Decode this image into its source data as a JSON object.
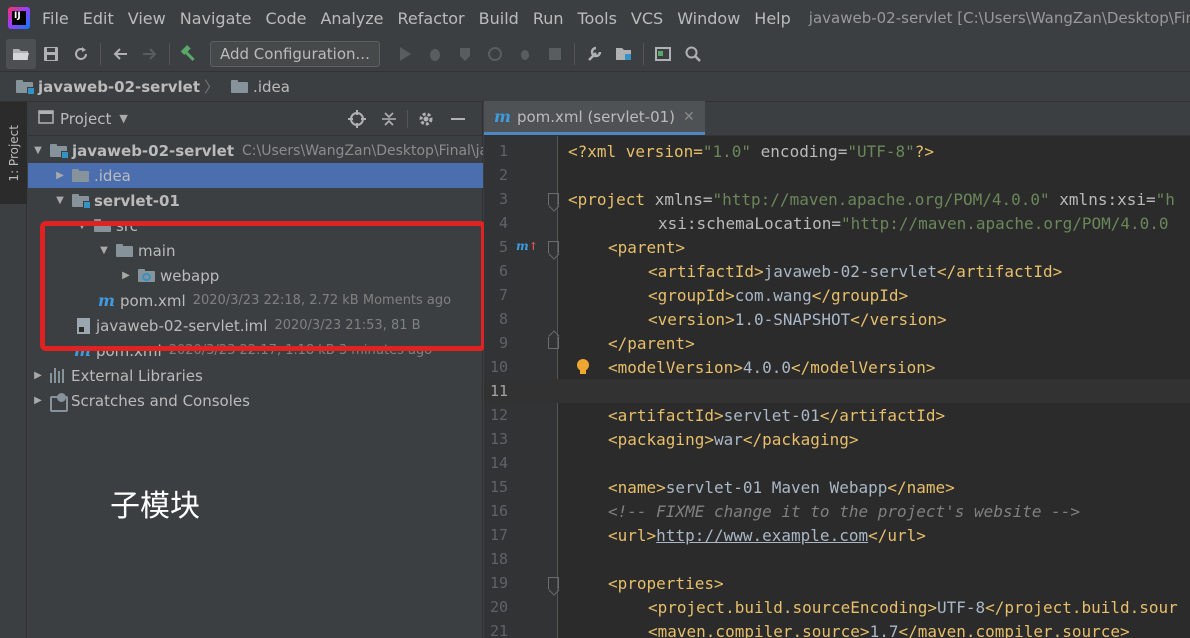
{
  "menu": {
    "items": [
      "File",
      "Edit",
      "View",
      "Navigate",
      "Code",
      "Analyze",
      "Refactor",
      "Build",
      "Run",
      "Tools",
      "VCS",
      "Window",
      "Help"
    ],
    "window_title": "javaweb-02-servlet [C:\\Users\\WangZan\\Desktop\\Final\\ja"
  },
  "toolbar": {
    "add_configuration": "Add Configuration..."
  },
  "breadcrumb": {
    "project": "javaweb-02-servlet",
    "folder": ".idea"
  },
  "left_stripe": {
    "tab_label": "1: Project"
  },
  "project_panel": {
    "title": "Project",
    "rows": [
      {
        "label": "javaweb-02-servlet",
        "path": "C:\\Users\\WangZan\\Desktop\\Final\\ja"
      },
      {
        "label": ".idea"
      },
      {
        "label": "servlet-01"
      },
      {
        "label": "src"
      },
      {
        "label": "main"
      },
      {
        "label": "webapp"
      },
      {
        "label": "pom.xml",
        "meta": "2020/3/23 22:18, 2.72 kB Moments ago"
      },
      {
        "label": "javaweb-02-servlet.iml",
        "meta": "2020/3/23 21:53, 81 B"
      },
      {
        "label": "pom.xml",
        "meta": "2020/3/23 22:17, 1.18 kB 3 minutes ago"
      },
      {
        "label": "External Libraries"
      },
      {
        "label": "Scratches and Consoles"
      }
    ],
    "annotation": "子模块"
  },
  "editor": {
    "tab_label": "pom.xml (servlet-01)",
    "line_numbers": [
      "1",
      "2",
      "3",
      "4",
      "5",
      "6",
      "7",
      "8",
      "9",
      "10",
      "11",
      "12",
      "13",
      "14",
      "15",
      "16",
      "17",
      "18",
      "19",
      "20",
      "21"
    ],
    "code": {
      "l1": [
        "<?xml version=",
        "\"1.0\"",
        " encoding=",
        "\"UTF-8\"",
        "?>"
      ],
      "l3": [
        "<project ",
        "xmlns=",
        "\"http://maven.apache.org/POM/4.0.0\"",
        " xmlns",
        ":xsi=",
        "\"h"
      ],
      "l4": [
        "xsi",
        ":schemaLocation=",
        "\"http://maven.apache.org/POM/4.0.0"
      ],
      "l5": [
        "<parent>"
      ],
      "l6": [
        "<artifactId>",
        "javaweb-02-servlet",
        "</artifactId>"
      ],
      "l7": [
        "<groupId>",
        "com.wang",
        "</groupId>"
      ],
      "l8": [
        "<version>",
        "1.0-SNAPSHOT",
        "</version>"
      ],
      "l9": [
        "</parent>"
      ],
      "l10": [
        "<modelVersion>",
        "4.0.0",
        "</modelVersion>"
      ],
      "l12": [
        "<artifactId>",
        "servlet-01",
        "</artifactId>"
      ],
      "l13": [
        "<packaging>",
        "war",
        "</packaging>"
      ],
      "l15": [
        "<name>",
        "servlet-01 Maven Webapp",
        "</name>"
      ],
      "l16": [
        "<!-- FIXME change it to the project's website -->"
      ],
      "l17": [
        "<url>",
        "http://www.example.com",
        "</url>"
      ],
      "l19": [
        "<properties>"
      ],
      "l20": [
        "<project.build.sourceEncoding>",
        "UTF-8",
        "</project.build.sour"
      ],
      "l21": [
        "<maven.compiler.source>",
        "1.7",
        "</maven.compiler.source>"
      ]
    }
  }
}
